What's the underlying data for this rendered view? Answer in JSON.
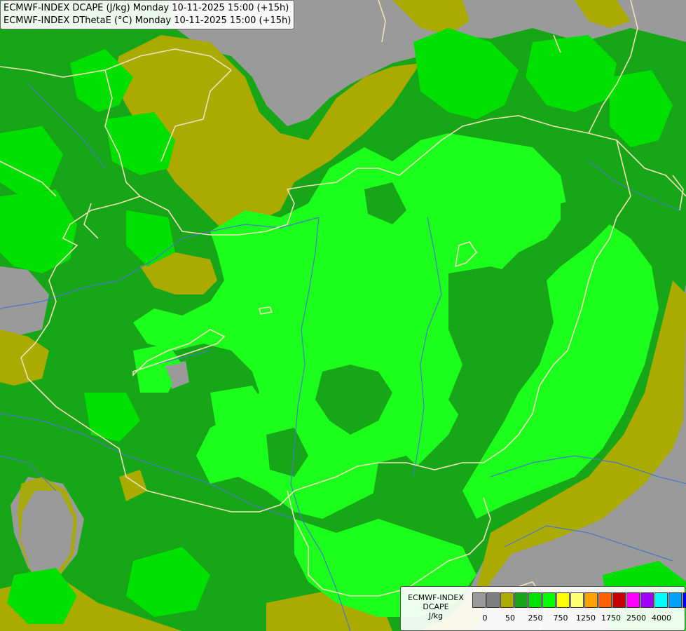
{
  "header": {
    "line1": "ECMWF-INDEX DCAPE (J/kg) Monday 10-11-2025 15:00 (+15h)",
    "line2": "ECMWF-INDEX DThetaE (°C) Monday 10-11-2025 15:00 (+15h)"
  },
  "legend": {
    "line1": "ECMWF-INDEX",
    "line2": "DCAPE",
    "line3": "J/kg",
    "colors": [
      "#9a9a9a",
      "#7e7e7e",
      "#aaaa00",
      "#17a617",
      "#00e000",
      "#00ff00",
      "#ffff00",
      "#ffff70",
      "#ffa000",
      "#ff6000",
      "#c80000",
      "#ff00ff",
      "#a000ff",
      "#00ffff",
      "#00a0ff",
      "#0000ff",
      "#00007a"
    ],
    "tick_labels": [
      "0",
      "50",
      "250",
      "750",
      "1250",
      "1750",
      "2500",
      "4000"
    ]
  },
  "colors": {
    "dark_green": "#17a617",
    "mid_green": "#00e000",
    "light_green": "#1cff1c",
    "olive": "#aaaa00",
    "grey": "#9a9a9a",
    "border": "#f0e2b8",
    "river": "#4a78c8"
  }
}
